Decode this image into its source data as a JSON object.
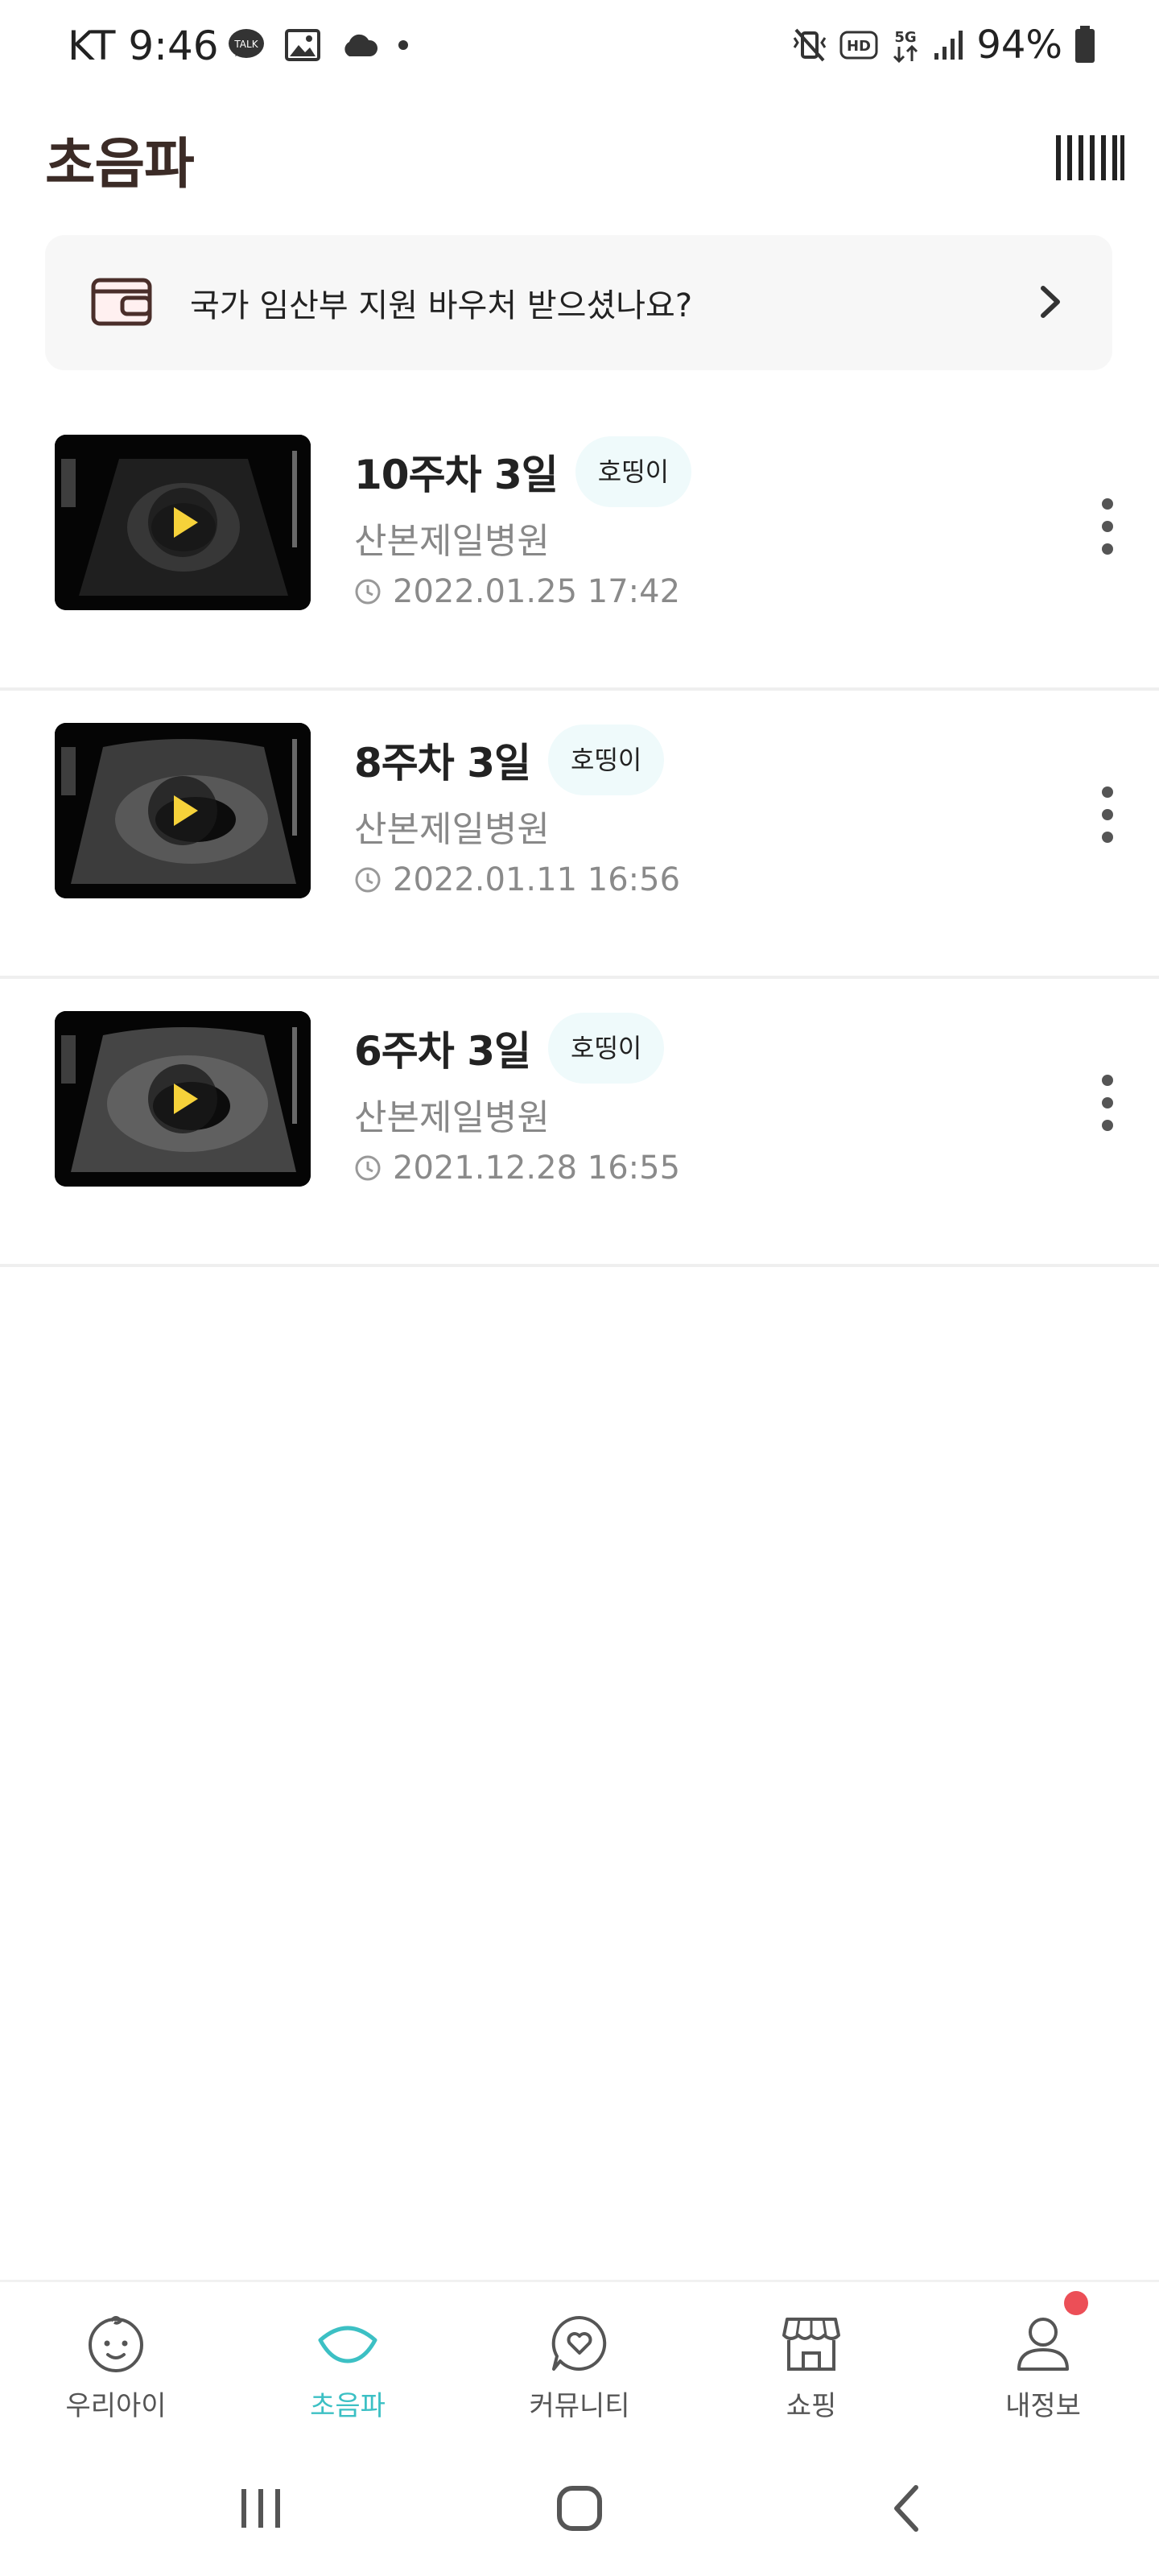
{
  "status_bar": {
    "time": "KT 9:46",
    "battery": "94%"
  },
  "header": {
    "title": "초음파"
  },
  "voucher": {
    "text": "국가 임산부 지원 바우처 받으셨나요?"
  },
  "scans": [
    {
      "title": "10주차 3일",
      "badge": "호띵이",
      "hospital": "산본제일병원",
      "datetime": "2022.01.25 17:42"
    },
    {
      "title": "8주차 3일",
      "badge": "호띵이",
      "hospital": "산본제일병원",
      "datetime": "2022.01.11 16:56"
    },
    {
      "title": "6주차 3일",
      "badge": "호띵이",
      "hospital": "산본제일병원",
      "datetime": "2021.12.28 16:55"
    }
  ],
  "bottom_nav": {
    "tabs": [
      {
        "label": "우리아이",
        "icon": "baby-face-icon"
      },
      {
        "label": "초음파",
        "icon": "ultrasound-icon",
        "active": true
      },
      {
        "label": "커뮤니티",
        "icon": "heart-chat-icon"
      },
      {
        "label": "쇼핑",
        "icon": "store-icon"
      },
      {
        "label": "내정보",
        "icon": "person-icon"
      }
    ]
  },
  "colors": {
    "accent": "#3cc0c4",
    "badge_bg": "#effafb",
    "notification": "#ec4f57",
    "title_brown": "#3b2b26"
  }
}
